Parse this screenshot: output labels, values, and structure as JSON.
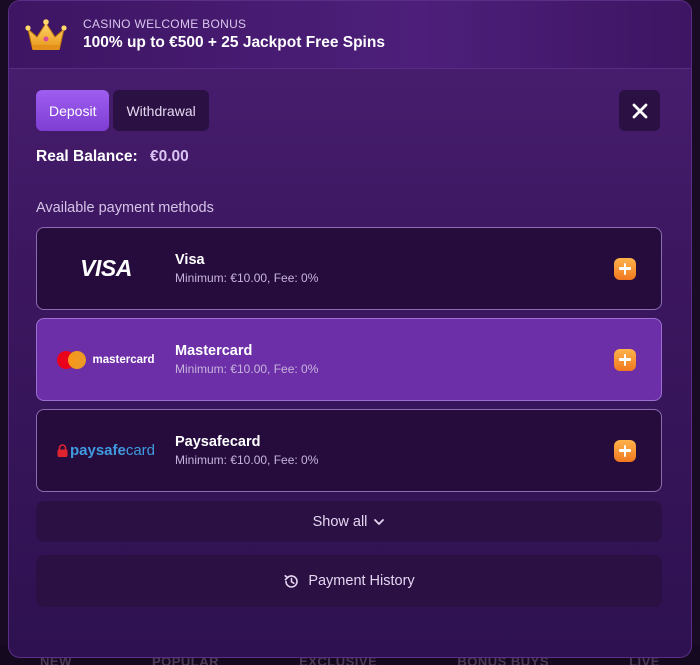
{
  "background_nav": [
    "NEW",
    "POPULAR",
    "EXCLUSIVE",
    "BONUS BUYS",
    "LIVE"
  ],
  "bonus": {
    "kicker": "CASINO WELCOME BONUS",
    "title": "100% up to €500 + 25 Jackpot Free Spins",
    "icon": "crown-icon"
  },
  "tabs": [
    {
      "label": "Deposit",
      "active": true
    },
    {
      "label": "Withdrawal",
      "active": false
    }
  ],
  "balance": {
    "label": "Real Balance:",
    "amount": "€0.00"
  },
  "methods_label": "Available payment methods",
  "methods": [
    {
      "name": "Visa",
      "meta": "Minimum: €10.00, Fee: 0%",
      "logo_text": "VISA",
      "selected": false
    },
    {
      "name": "Mastercard",
      "meta": "Minimum: €10.00, Fee: 0%",
      "logo_text": "mastercard",
      "selected": true
    },
    {
      "name": "Paysafecard",
      "meta": "Minimum: €10.00, Fee: 0%",
      "logo_text_a": "paysafe",
      "logo_text_b": "card",
      "selected": false
    }
  ],
  "show_all": "Show all",
  "payment_history": "Payment History",
  "colors": {
    "accent": "#8e4fe3",
    "plus": "#f5902c",
    "panel": "#3c1760"
  }
}
